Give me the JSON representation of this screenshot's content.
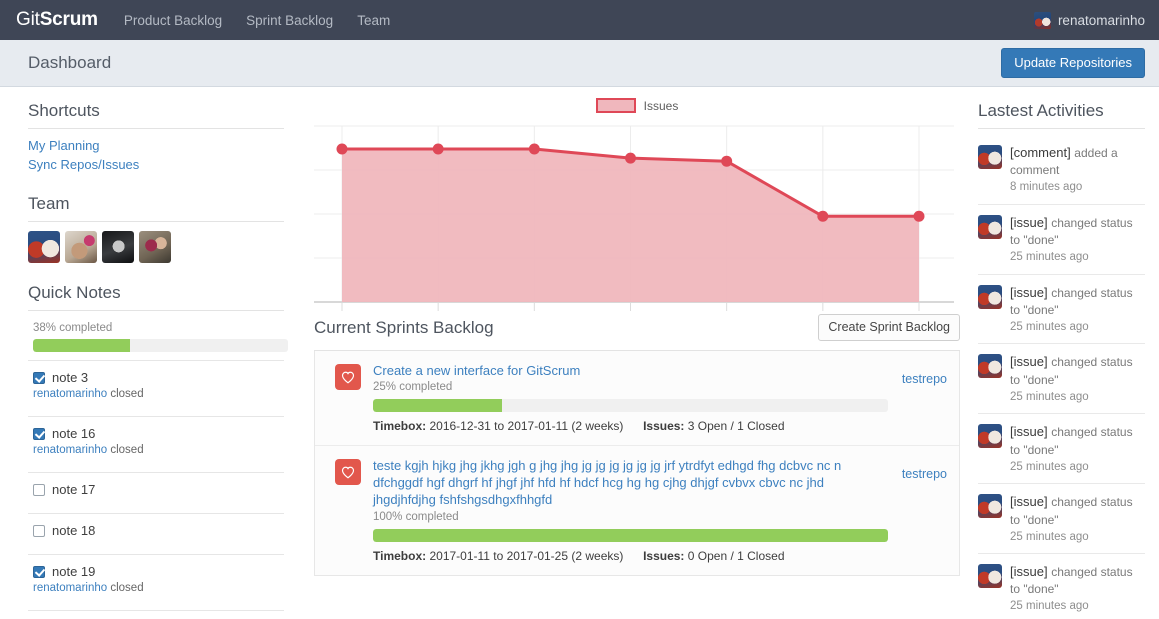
{
  "navbar": {
    "brand_light": "Git",
    "brand_bold": "Scrum",
    "links": [
      {
        "label": "Product Backlog"
      },
      {
        "label": "Sprint Backlog"
      },
      {
        "label": "Team"
      }
    ],
    "user": "renatomarinho",
    "avatar_icon": "user-avatar-icon"
  },
  "subheader": {
    "title": "Dashboard",
    "update_button": "Update Repositories"
  },
  "sidebar": {
    "shortcuts": {
      "title": "Shortcuts",
      "items": [
        {
          "label": "My Planning"
        },
        {
          "label": "Sync Repos/Issues"
        }
      ]
    },
    "team": {
      "title": "Team",
      "members": [
        {
          "name": "team-avatar-1"
        },
        {
          "name": "team-avatar-2"
        },
        {
          "name": "team-avatar-3"
        },
        {
          "name": "team-avatar-4"
        }
      ]
    },
    "quick_notes": {
      "title": "Quick Notes",
      "progress_label": "38% completed",
      "progress_percent": 38,
      "notes": [
        {
          "label": "note 3",
          "checked": true,
          "author": "renatomarinho",
          "status": "closed"
        },
        {
          "label": "note 16",
          "checked": true,
          "author": "renatomarinho",
          "status": "closed"
        },
        {
          "label": "note 17",
          "checked": false,
          "author": "",
          "status": ""
        },
        {
          "label": "note 18",
          "checked": false,
          "author": "",
          "status": ""
        },
        {
          "label": "note 19",
          "checked": true,
          "author": "renatomarinho",
          "status": "closed"
        }
      ]
    }
  },
  "chart_data": {
    "type": "area",
    "title": "",
    "legend": [
      "Issues"
    ],
    "legend_position": "top-center",
    "series": [
      {
        "name": "Issues",
        "values": [
          10,
          10,
          10,
          9.4,
          9.2,
          5.6,
          5.6
        ],
        "line_color": "#df4857",
        "fill_color": "#f0b7bd"
      }
    ],
    "x": [
      1,
      2,
      3,
      4,
      5,
      6,
      7
    ],
    "ylim": [
      0,
      11.5
    ],
    "grid": true,
    "xlabel": "",
    "ylabel": ""
  },
  "sprints": {
    "title": "Current Sprints Backlog",
    "create_button": "Create Sprint Backlog",
    "items": [
      {
        "favorite_icon": "heart-icon",
        "name": "Create a new interface for GitScrum",
        "percent_label": "25% completed",
        "percent": 25,
        "timebox_label": "Timebox:",
        "timebox_value": "2016-12-31 to 2017-01-11 (2 weeks)",
        "issues_label": "Issues:",
        "issues_value": "3 Open / 1 Closed",
        "repo": "testrepo"
      },
      {
        "favorite_icon": "heart-icon",
        "name": "teste kgjh hjkg jhg jkhg jgh g jhg jhg jg jg jg jg jg jg jrf ytrdfyt edhgd fhg dcbvc nc n dfchggdf hgf dhgrf hf jhgf jhf hfd hf hdcf hcg hg hg cjhg dhjgf cvbvx cbvc nc jhd jhgdjhfdjhg fshfshgsdhgxfhhgfd",
        "percent_label": "100% completed",
        "percent": 100,
        "timebox_label": "Timebox:",
        "timebox_value": "2017-01-11 to 2017-01-25 (2 weeks)",
        "issues_label": "Issues:",
        "issues_value": "0 Open / 1 Closed",
        "repo": "testrepo"
      }
    ]
  },
  "activities": {
    "title": "Lastest Activities",
    "items": [
      {
        "subject": "[comment]",
        "action": "added a comment",
        "time": "8 minutes ago"
      },
      {
        "subject": "[issue]",
        "action": "changed status to \"done\"",
        "time": "25 minutes ago"
      },
      {
        "subject": "[issue]",
        "action": "changed status to \"done\"",
        "time": "25 minutes ago"
      },
      {
        "subject": "[issue]",
        "action": "changed status to \"done\"",
        "time": "25 minutes ago"
      },
      {
        "subject": "[issue]",
        "action": "changed status to \"done\"",
        "time": "25 minutes ago"
      },
      {
        "subject": "[issue]",
        "action": "changed status to \"done\"",
        "time": "25 minutes ago"
      },
      {
        "subject": "[issue]",
        "action": "changed status to \"done\"",
        "time": "25 minutes ago"
      }
    ]
  },
  "colors": {
    "navbar_bg": "#3f4656",
    "primary": "#3479b7",
    "accent_green": "#92cd5b",
    "accent_red": "#e2574c",
    "chart_line": "#df4857",
    "chart_fill": "#f0b7bd",
    "link": "#3d80bf"
  }
}
